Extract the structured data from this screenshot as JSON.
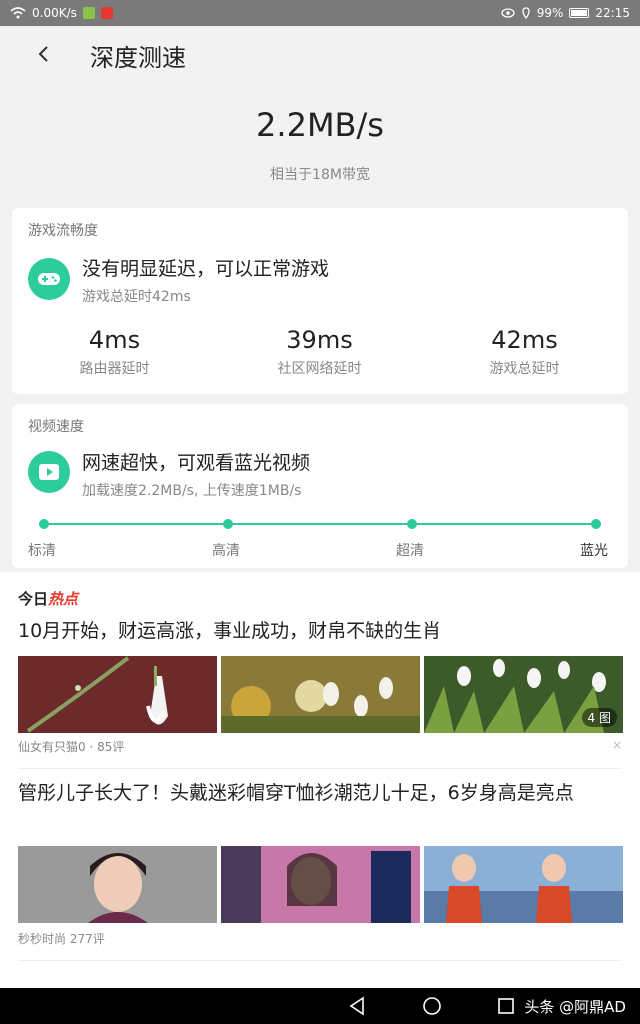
{
  "status_bar": {
    "speed": "0.00K/s",
    "battery": "99%",
    "time": "22:15"
  },
  "header": {
    "title": "深度测速"
  },
  "result": {
    "speed": "2.2MB/s",
    "equivalent": "相当于18M带宽"
  },
  "game_card": {
    "title": "游戏流畅度",
    "main": "没有明显延迟，可以正常游戏",
    "sub": "游戏总延时42ms",
    "metrics": [
      {
        "value": "4ms",
        "label": "路由器延时"
      },
      {
        "value": "39ms",
        "label": "社区网络延时"
      },
      {
        "value": "42ms",
        "label": "游戏总延时"
      }
    ]
  },
  "video_card": {
    "title": "视频速度",
    "main": "网速超快，可观看蓝光视频",
    "sub": "加载速度2.2MB/s, 上传速度1MB/s",
    "levels": [
      "标清",
      "高清",
      "超清",
      "蓝光"
    ],
    "current_level": "蓝光"
  },
  "feed": {
    "hot_prefix": "今日",
    "hot_label": "热点",
    "items": [
      {
        "title": "10月开始，财运高涨，事业成功，财帛不缺的生肖",
        "author": "仙女有只猫0",
        "comments": "85评",
        "image_count": "4 图"
      },
      {
        "title": "管彤儿子长大了！头戴迷彩帽穿T恤衫潮范儿十足，6岁身高是亮点",
        "author": "秒秒时尚",
        "comments": "277评"
      }
    ],
    "dismiss": "×"
  },
  "nav": {
    "brand": "头条 @阿鼎AD"
  },
  "colors": {
    "accent": "#2ecc9a",
    "hot_red": "#e63b2e"
  }
}
